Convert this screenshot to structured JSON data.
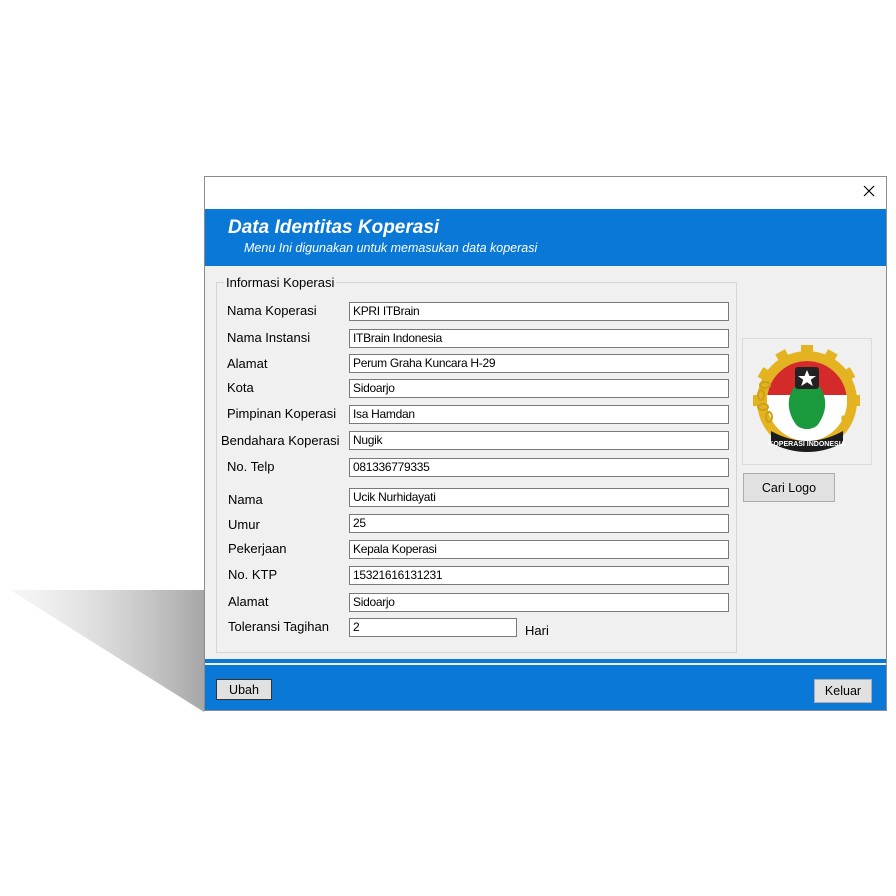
{
  "window": {
    "close_glyph": "✕"
  },
  "banner": {
    "title": "Data Identitas Koperasi",
    "subtitle": "Menu Ini digunakan untuk memasukan data koperasi"
  },
  "group": {
    "legend": "Informasi Koperasi"
  },
  "fields": {
    "nama_koperasi": {
      "label": "Nama Koperasi",
      "value": "KPRI ITBrain"
    },
    "nama_instansi": {
      "label": "Nama Instansi",
      "value": "ITBrain Indonesia"
    },
    "alamat": {
      "label": "Alamat",
      "value": "Perum Graha Kuncara H-29"
    },
    "kota": {
      "label": "Kota",
      "value": "Sidoarjo"
    },
    "pimpinan": {
      "label": "Pimpinan Koperasi",
      "value": "Isa Hamdan"
    },
    "bendahara": {
      "label": "Bendahara Koperasi",
      "value": "Nugik"
    },
    "telp": {
      "label": "No. Telp",
      "value": "081336779335"
    },
    "nama": {
      "label": "Nama",
      "value": "Ucik Nurhidayati"
    },
    "umur": {
      "label": "Umur",
      "value": "25"
    },
    "pekerjaan": {
      "label": "Pekerjaan",
      "value": "Kepala Koperasi"
    },
    "ktp": {
      "label": "No. KTP",
      "value": "15321616131231"
    },
    "alamat2": {
      "label": "Alamat",
      "value": "Sidoarjo"
    },
    "toleransi": {
      "label": "Toleransi Tagihan",
      "value": "2",
      "unit": "Hari"
    }
  },
  "logo": {
    "icon": "koperasi-indonesia-logo-icon",
    "text": "KOPERASI INDONESIA"
  },
  "buttons": {
    "cari_logo": "Cari Logo",
    "ubah": "Ubah",
    "keluar": "Keluar"
  },
  "colors": {
    "accent": "#0a78d7",
    "window_bg": "#f0f0f0"
  }
}
